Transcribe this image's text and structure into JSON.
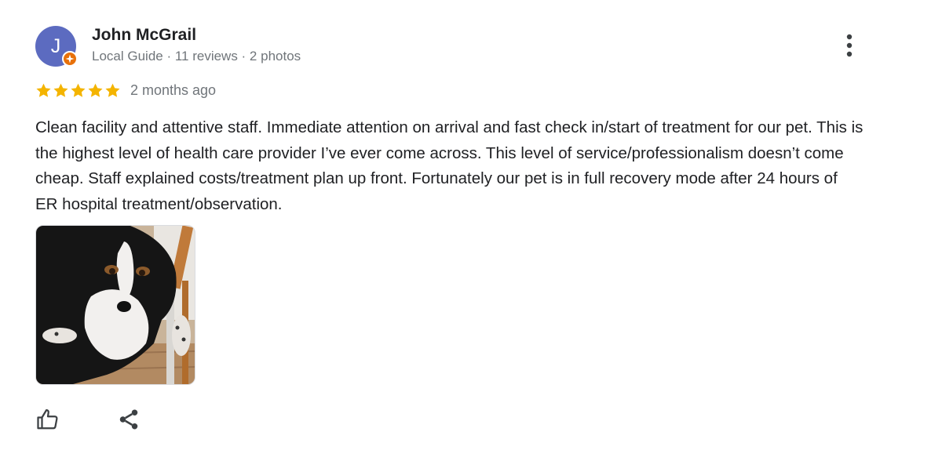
{
  "reviewer": {
    "initial": "J",
    "name": "John McGrail",
    "meta": "Local Guide · 11 reviews · 2 photos",
    "avatar_color": "#5c6bc0",
    "badge_color": "#e8710a"
  },
  "review": {
    "rating": 5,
    "rating_max": 5,
    "star_color": "#f4b400",
    "date": "2 months ago",
    "text": "Clean facility and attentive staff. Immediate attention on arrival and fast check in/start of treatment for our pet. This is the highest level of health care provider I’ve ever come across. This level of service/professionalism doesn’t come cheap. Staff explained costs/treatment plan up front. Fortunately our pet is in full recovery mode after 24 hours of ER hospital treatment/observation.",
    "photos": [
      {
        "subject": "dog-photo"
      }
    ]
  },
  "actions": {
    "more_icon": "more-vertical-icon",
    "like_icon": "thumbs-up-icon",
    "share_icon": "share-icon"
  }
}
